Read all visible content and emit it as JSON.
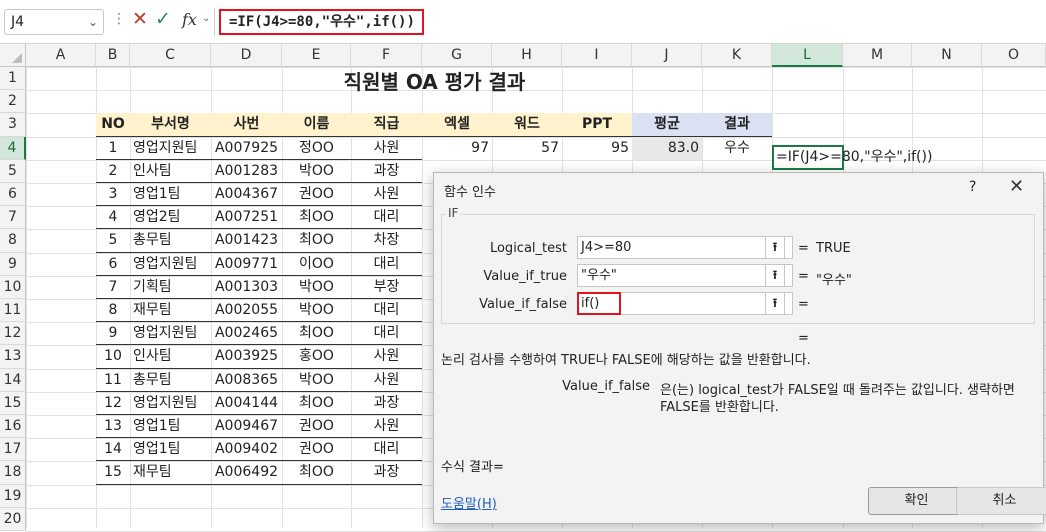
{
  "namebox": "J4",
  "formula": "=IF(J4>=80,\"우수\",if())",
  "fx": "fx",
  "columns": [
    "A",
    "B",
    "C",
    "D",
    "E",
    "F",
    "G",
    "H",
    "I",
    "J",
    "K",
    "L",
    "M",
    "N",
    "O"
  ],
  "rows": [
    "1",
    "2",
    "3",
    "4",
    "5",
    "6",
    "7",
    "8",
    "9",
    "10",
    "11",
    "12",
    "13",
    "14",
    "15",
    "16",
    "17",
    "18",
    "19",
    "20"
  ],
  "title": "직원별 OA 평가 결과",
  "headers": [
    "NO",
    "부서명",
    "사번",
    "이름",
    "직급",
    "엑셀",
    "워드",
    "PPT",
    "평균",
    "결과"
  ],
  "table": [
    [
      "1",
      "영업지원팀",
      "A007925",
      "정OO",
      "사원",
      "97",
      "57",
      "95",
      "83.0",
      "우수"
    ],
    [
      "2",
      "인사팀",
      "A001283",
      "박OO",
      "과장"
    ],
    [
      "3",
      "영업1팀",
      "A004367",
      "권OO",
      "사원"
    ],
    [
      "4",
      "영업2팀",
      "A007251",
      "최OO",
      "대리"
    ],
    [
      "5",
      "총무팀",
      "A001423",
      "최OO",
      "차장"
    ],
    [
      "6",
      "영업지원팀",
      "A009771",
      "이OO",
      "대리"
    ],
    [
      "7",
      "기획팀",
      "A001303",
      "박OO",
      "부장"
    ],
    [
      "8",
      "재무팀",
      "A002055",
      "박OO",
      "대리"
    ],
    [
      "9",
      "영업지원팀",
      "A002465",
      "최OO",
      "대리"
    ],
    [
      "10",
      "인사팀",
      "A003925",
      "홍OO",
      "사원"
    ],
    [
      "11",
      "총무팀",
      "A008365",
      "박OO",
      "사원"
    ],
    [
      "12",
      "영업지원팀",
      "A004144",
      "최OO",
      "과장"
    ],
    [
      "13",
      "영업1팀",
      "A009467",
      "권OO",
      "사원"
    ],
    [
      "14",
      "영업1팀",
      "A009402",
      "권OO",
      "대리"
    ],
    [
      "15",
      "재무팀",
      "A006492",
      "최OO",
      "과장"
    ]
  ],
  "active_cell_text": "=IF(J4>=80,\"우수\",if())",
  "dialog": {
    "title": "함수 인수",
    "help": "?",
    "close": "✕",
    "group": "IF",
    "args": [
      {
        "label": "Logical_test",
        "value": "J4>=80",
        "result": "TRUE"
      },
      {
        "label": "Value_if_true",
        "value": "\"우수\"",
        "result": "\"우수\""
      },
      {
        "label": "Value_if_false",
        "value": "if()",
        "result": ""
      }
    ],
    "eq": "=",
    "description": "논리 검사를 수행하여 TRUE나 FALSE에 해당하는 값을 반환합니다.",
    "arg_name": "Value_if_false",
    "arg_desc_1": "은(는) logical_test가 FALSE일 때 돌려주는 값입니다. 생략하면",
    "arg_desc_2": "FALSE를 반환합니다.",
    "formula_result_label": "수식 결과=",
    "help_link": "도움말(H)",
    "ok": "확인",
    "cancel": "취소"
  },
  "colors": {
    "accent_green": "#1a7a44",
    "highlight_red": "#e0141e",
    "header_yellow": "#fff2cc",
    "header_blue": "#d9e1f2"
  }
}
